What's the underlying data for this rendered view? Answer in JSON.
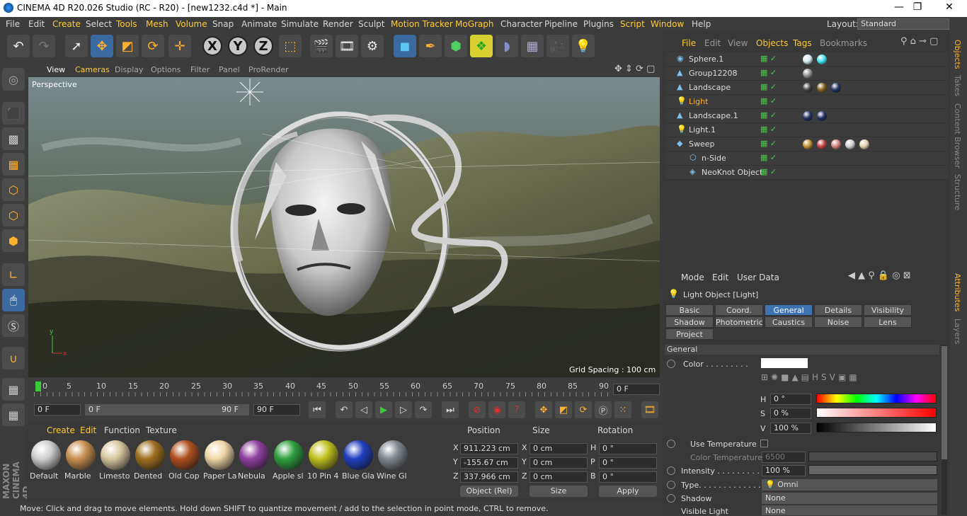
{
  "window": {
    "title": "CINEMA 4D R20.026 Studio (RC - R20) - [new1232.c4d *] - Main",
    "min": "—",
    "max": "❐",
    "close": "✕"
  },
  "menu": [
    "File",
    "Edit",
    "Create",
    "Select",
    "Tools",
    "Mesh",
    "Volume",
    "Snap",
    "Animate",
    "Simulate",
    "Render",
    "Sculpt",
    "Motion Tracker",
    "MoGraph",
    "Character",
    "Pipeline",
    "Plugins",
    "Script",
    "Window",
    "Help"
  ],
  "layout": {
    "label": "Layout:",
    "value": "Standard"
  },
  "viewport": {
    "menu": [
      "View",
      "Cameras",
      "Display",
      "Options",
      "Filter",
      "Panel",
      "ProRender"
    ],
    "camera": "Perspective",
    "grid_spacing": "Grid Spacing : 100 cm"
  },
  "timeline": {
    "ticks": [
      "0",
      "5",
      "10",
      "15",
      "20",
      "25",
      "30",
      "35",
      "40",
      "45",
      "50",
      "55",
      "60",
      "65",
      "70",
      "75",
      "80",
      "85",
      "90"
    ],
    "current_frame": "0 F",
    "start": "0 F",
    "range_start": "0 F",
    "range_end": "90 F",
    "end": "90 F"
  },
  "materials": {
    "menu": [
      "Create",
      "Edit",
      "Function",
      "Texture"
    ],
    "items": [
      {
        "label": "Default",
        "color": "#d0d0d0"
      },
      {
        "label": "Marble",
        "color": "#c89050"
      },
      {
        "label": "Limesto",
        "color": "#d8c8a0"
      },
      {
        "label": "Dented",
        "color": "#a07020"
      },
      {
        "label": "Old Cop",
        "color": "#b05020"
      },
      {
        "label": "Paper La",
        "color": "#f0d8a8"
      },
      {
        "label": "Nebula",
        "color": "#9040a0"
      },
      {
        "label": "Apple sl",
        "color": "#30a040"
      },
      {
        "label": "10 Pin 4",
        "color": "#c0c020"
      },
      {
        "label": "Blue Gla",
        "color": "#2040c0"
      },
      {
        "label": "Wine Gl",
        "color": "#808890"
      }
    ]
  },
  "coords": {
    "headers": [
      "Position",
      "Size",
      "Rotation"
    ],
    "rows": [
      {
        "axis": "X",
        "pos": "911.223 cm",
        "saxis": "X",
        "size": "0 cm",
        "raxis": "H",
        "rot": "0 °"
      },
      {
        "axis": "Y",
        "pos": "-155.67 cm",
        "saxis": "Y",
        "size": "0 cm",
        "raxis": "P",
        "rot": "0 °"
      },
      {
        "axis": "Z",
        "pos": "337.966 cm",
        "saxis": "Z",
        "size": "0 cm",
        "raxis": "B",
        "rot": "0 °"
      }
    ],
    "mode": "Object (Rel)",
    "size_mode": "Size",
    "apply": "Apply"
  },
  "status": "Move: Click and drag to move elements. Hold down SHIFT to quantize movement / add to the selection in point mode, CTRL to remove.",
  "objects": {
    "tabs": [
      "File",
      "Edit",
      "View",
      "Objects",
      "Tags",
      "Bookmarks"
    ],
    "items": [
      {
        "name": "Sphere.1",
        "tags": [
          "#cfe8f0",
          "#40e0f0"
        ]
      },
      {
        "name": "Group12208",
        "tags": [
          "#909090"
        ]
      },
      {
        "name": "Landscape",
        "tags": [
          "#404040",
          "#806020",
          "#203060"
        ]
      },
      {
        "name": "Light",
        "tags": []
      },
      {
        "name": "Landscape.1",
        "tags": [
          "#203060",
          "#203060"
        ]
      },
      {
        "name": "Light.1",
        "tags": []
      },
      {
        "name": "Sweep",
        "tags": [
          "#c09030",
          "#c04040",
          "#d08080",
          "#d0d0d0",
          "#e0d0b0"
        ]
      },
      {
        "name": "n-Side",
        "tags": []
      },
      {
        "name": "NeoKnot Object",
        "tags": []
      }
    ]
  },
  "attributes": {
    "menu": [
      "Mode",
      "Edit",
      "User Data"
    ],
    "title": "Light Object [Light]",
    "tabs": [
      "Basic",
      "Coord.",
      "General",
      "Details",
      "Visibility",
      "Shadow",
      "Photometric",
      "Caustics",
      "Noise",
      "Lens",
      "Project"
    ],
    "section": "General",
    "color_label": "Color . . . . . . . . .",
    "h": {
      "label": "H",
      "value": "0 °"
    },
    "s": {
      "label": "S",
      "value": "0 %"
    },
    "v": {
      "label": "V",
      "value": "100 %"
    },
    "use_temp": "Use Temperature",
    "color_temp": {
      "label": "Color Temperature",
      "value": "6500"
    },
    "intensity": {
      "label": "Intensity . . . . . . . . .",
      "value": "100 %"
    },
    "type": {
      "label": "Type. . . . . . . . . . . . .",
      "value": "Omni"
    },
    "shadow": {
      "label": "Shadow",
      "value": "None"
    },
    "visible_light": {
      "label": "Visible Light",
      "value": "None"
    }
  },
  "side_tabs": [
    "Objects",
    "Takes",
    "Content Browser",
    "Structure",
    "Attributes",
    "Layers"
  ]
}
